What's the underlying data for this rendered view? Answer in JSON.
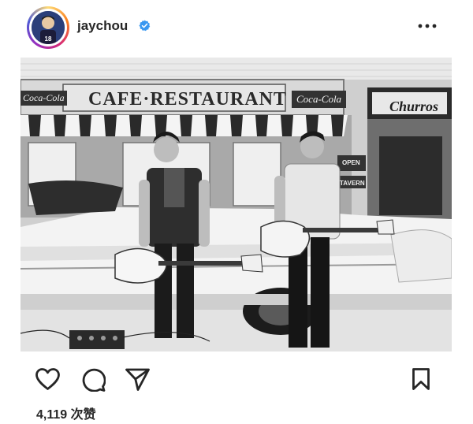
{
  "post": {
    "username": "jaychou",
    "verified_icon": "verified-badge-icon",
    "more_icon": "more-options-icon",
    "avatar_jersey_number": "18"
  },
  "photo": {
    "signs": {
      "main": "CAFE·RESTAURANT",
      "cola_left": "Coca-Cola",
      "cola_right": "Coca-Cola",
      "churros": "Churros",
      "open": "OPEN",
      "tavern": "TAVERN"
    }
  },
  "actions": {
    "like_icon": "heart-icon",
    "comment_icon": "comment-icon",
    "share_icon": "send-icon",
    "save_icon": "bookmark-icon"
  },
  "likes": {
    "text": "4,119 次赞"
  },
  "colors": {
    "verified_blue": "#3897f0",
    "text": "#262626",
    "ring_gradient": [
      "#feda75",
      "#fa7e1e",
      "#d62976",
      "#962fbf",
      "#4f5bd5"
    ]
  }
}
